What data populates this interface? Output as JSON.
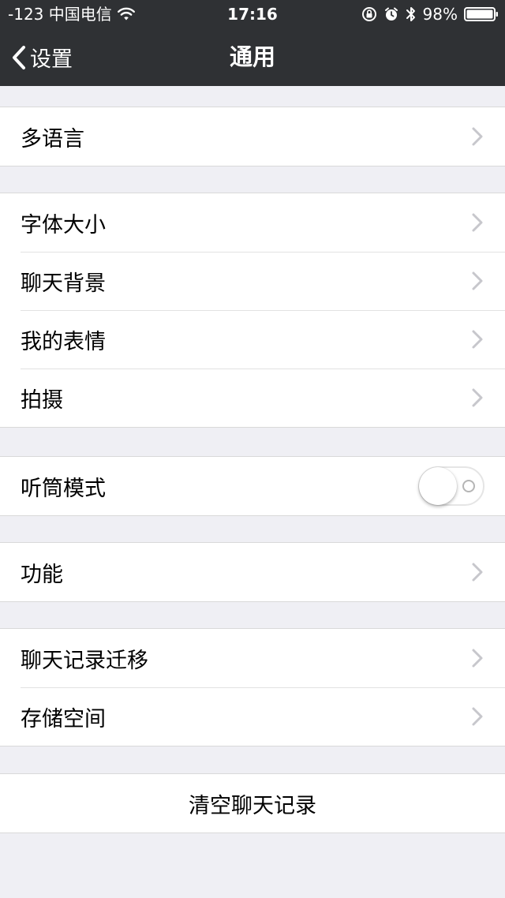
{
  "status_bar": {
    "carrier": "-123 中国电信",
    "time": "17:16",
    "battery": "98%"
  },
  "nav": {
    "back_label": "设置",
    "title": "通用"
  },
  "groups": {
    "language": {
      "label": "多语言"
    },
    "display": {
      "font_size": "字体大小",
      "chat_background": "聊天背景",
      "my_stickers": "我的表情",
      "camera": "拍摄"
    },
    "earpiece": {
      "label": "听筒模式",
      "toggle_on": false
    },
    "features": {
      "label": "功能"
    },
    "storage": {
      "chat_migration": "聊天记录迁移",
      "storage_space": "存储空间"
    },
    "clear": {
      "label": "清空聊天记录"
    }
  },
  "colors": {
    "topbar": "#2f3134",
    "background": "#efeff4",
    "chevron": "#c7c7cc"
  }
}
